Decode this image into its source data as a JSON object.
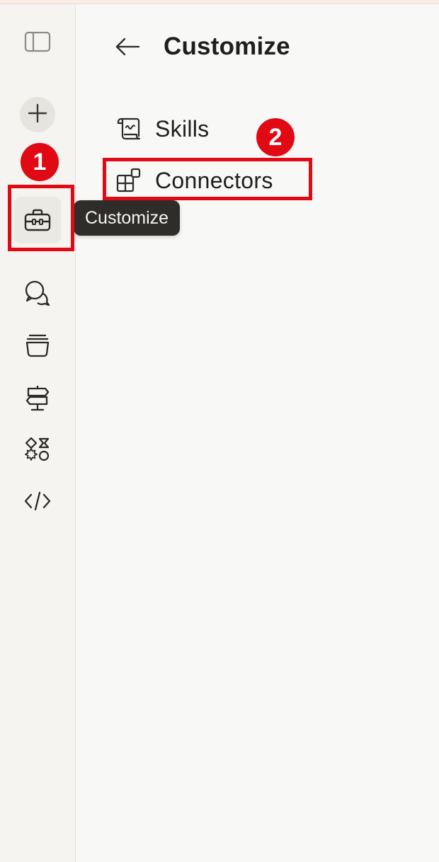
{
  "window": {
    "title": "Customize"
  },
  "sidebar": {
    "items": [
      {
        "name": "toggle-sidebar",
        "icon": "sidebar-panel-icon"
      },
      {
        "name": "new-chat",
        "icon": "plus-icon"
      },
      {
        "name": "customize",
        "icon": "toolbox-icon",
        "active": true
      },
      {
        "name": "chats",
        "icon": "chat-bubbles-icon"
      },
      {
        "name": "projects",
        "icon": "stack-icon"
      },
      {
        "name": "signpost",
        "icon": "signpost-icon"
      },
      {
        "name": "artifacts",
        "icon": "shapes-icon"
      },
      {
        "name": "code",
        "icon": "code-icon"
      }
    ],
    "tooltip": "Customize"
  },
  "main": {
    "title": "Customize",
    "back_icon": "arrow-left-icon",
    "nav": [
      {
        "label": "Skills",
        "icon": "scroll-icon"
      },
      {
        "label": "Connectors",
        "icon": "connectors-icon"
      }
    ]
  },
  "annotations": {
    "badge_1": "1",
    "badge_2": "2",
    "color": "#e00914"
  },
  "colors": {
    "background": "#f8f8f6",
    "sidebar": "#f5f4f0",
    "tooltip_bg": "#2e2d2a",
    "annotation_red": "#e00914"
  }
}
